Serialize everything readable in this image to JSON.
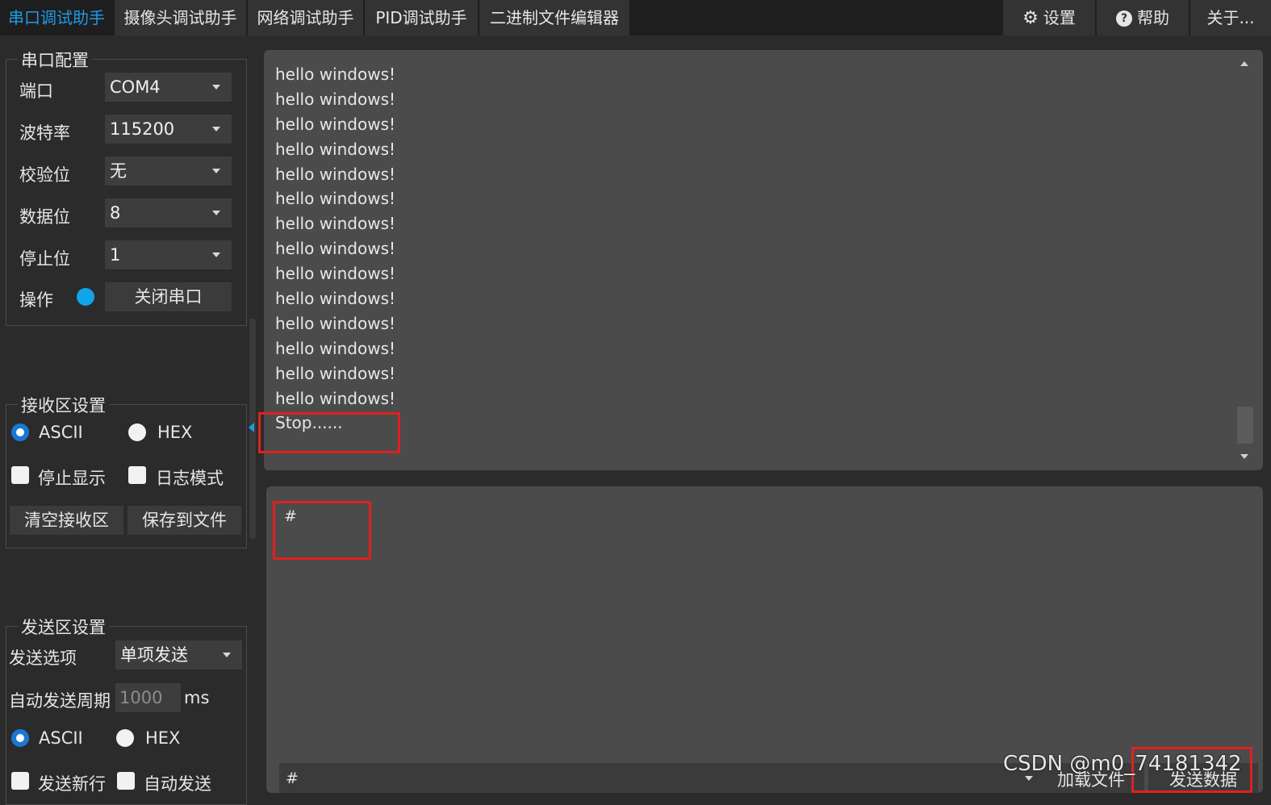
{
  "tabs": [
    {
      "label": "串口调试助手",
      "active": true
    },
    {
      "label": "摄像头调试助手",
      "active": false
    },
    {
      "label": "网络调试助手",
      "active": false
    },
    {
      "label": "PID调试助手",
      "active": false
    },
    {
      "label": "二进制文件编辑器",
      "active": false
    }
  ],
  "toolbar": {
    "settings_label": "设置",
    "help_label": "帮助",
    "about_label": "关于..."
  },
  "serial_config": {
    "title": "串口配置",
    "port_label": "端口",
    "port_value": "COM4",
    "baud_label": "波特率",
    "baud_value": "115200",
    "parity_label": "校验位",
    "parity_value": "无",
    "databits_label": "数据位",
    "databits_value": "8",
    "stopbits_label": "停止位",
    "stopbits_value": "1",
    "action_label": "操作",
    "action_button": "关闭串口"
  },
  "recv_settings": {
    "title": "接收区设置",
    "ascii_label": "ASCII",
    "hex_label": "HEX",
    "mode": "ASCII",
    "stop_display_label": "停止显示",
    "log_mode_label": "日志模式",
    "clear_button": "清空接收区",
    "save_button": "保存到文件"
  },
  "send_settings": {
    "title": "发送区设置",
    "option_label": "发送选项",
    "option_value": "单项发送",
    "period_label": "自动发送周期",
    "period_value": "1000",
    "period_unit": "ms",
    "ascii_label": "ASCII",
    "hex_label": "HEX",
    "mode": "ASCII",
    "newline_label": "发送新行",
    "auto_send_label": "自动发送"
  },
  "receive_area": {
    "lines": [
      "hello windows!",
      "hello windows!",
      "hello windows!",
      "hello windows!",
      "hello windows!",
      "hello windows!",
      "hello windows!",
      "hello windows!",
      "hello windows!",
      "hello windows!",
      "hello windows!",
      "hello windows!",
      "hello windows!",
      "hello windows!",
      "Stop......"
    ]
  },
  "send_area": {
    "text": "#",
    "history_value": "#",
    "load_file_button": "加载文件",
    "send_button": "发送数据"
  },
  "watermark": "CSDN @m0_74181342",
  "colors": {
    "accent": "#1e9be6",
    "annotation": "#e02020",
    "led": "#12a4e8"
  }
}
